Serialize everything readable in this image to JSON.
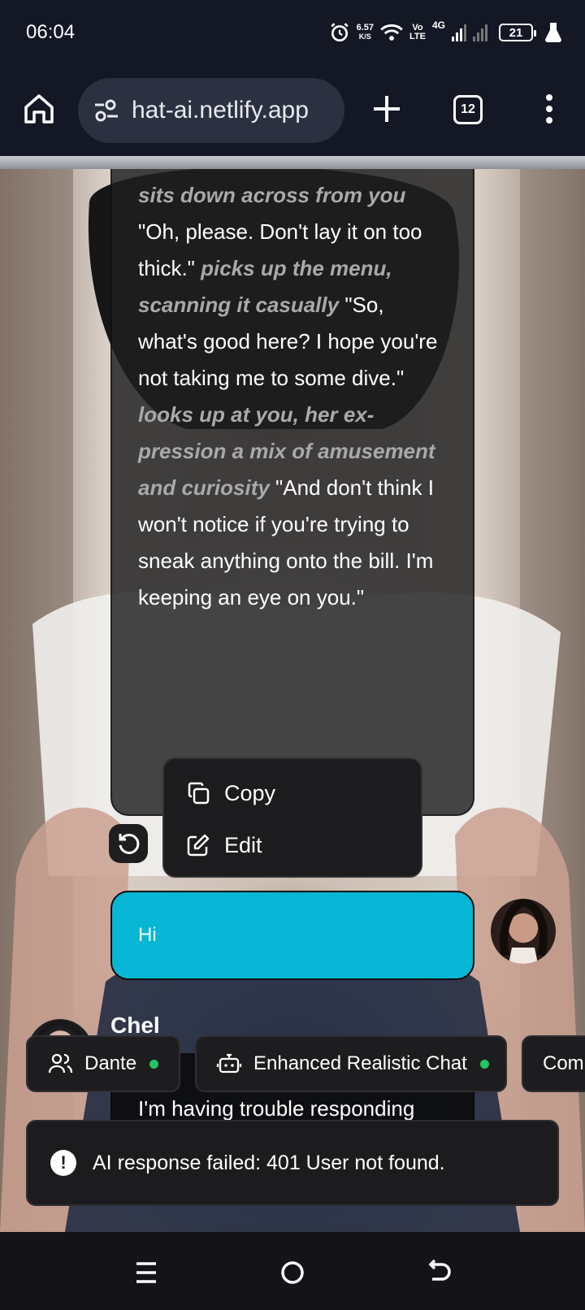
{
  "status_bar": {
    "time": "06:04",
    "net_speed_value": "6.57",
    "net_speed_unit": "K/S",
    "volte_top": "Vo",
    "volte_bottom": "LTE",
    "network": "4G",
    "battery": "21",
    "icons": [
      "alarm-icon",
      "wifi-icon",
      "signal-icon",
      "beaker-icon"
    ]
  },
  "browser": {
    "url": "hat-ai.netlify.app",
    "tab_count": "12",
    "icons": [
      "home-icon",
      "tune-icon",
      "plus-icon",
      "more-vert-icon"
    ]
  },
  "chat": {
    "first_message": {
      "segments": [
        {
          "type": "action",
          "text": "sits down across from you"
        },
        {
          "type": "speech",
          "text": " \"Oh, please. Don't lay it on too thick.\" "
        },
        {
          "type": "action",
          "text": "picks up the menu, scanning it casually"
        },
        {
          "type": "speech",
          "text": " \"So, what's good here? I hope you're not taking me to some dive.\" "
        },
        {
          "type": "action",
          "text": "looks up at you, her ex­pression a mix of amusement and curiosity"
        },
        {
          "type": "speech",
          "text": " \"And don't think I won't notice if you're trying to sneak anything onto the bill. I'm keeping an eye on you.\""
        }
      ]
    },
    "user_message": "Hi",
    "ai_name": "Chel",
    "error_message": "I'm having trouble responding right now. Please try again."
  },
  "context_menu": {
    "copy_label": "Copy",
    "edit_label": "Edit"
  },
  "chips": [
    {
      "label": "Dante",
      "icon": "users-icon",
      "active": true
    },
    {
      "label": "Enhanced Realistic Chat",
      "icon": "bot-icon",
      "active": true
    },
    {
      "label": "Com",
      "icon": "",
      "active": false
    }
  ],
  "toast": {
    "message": "AI response failed: 401 User not found."
  },
  "colors": {
    "user_bubble": "#06b6d4",
    "active_dot": "#22c55e",
    "chrome": "#141824"
  }
}
